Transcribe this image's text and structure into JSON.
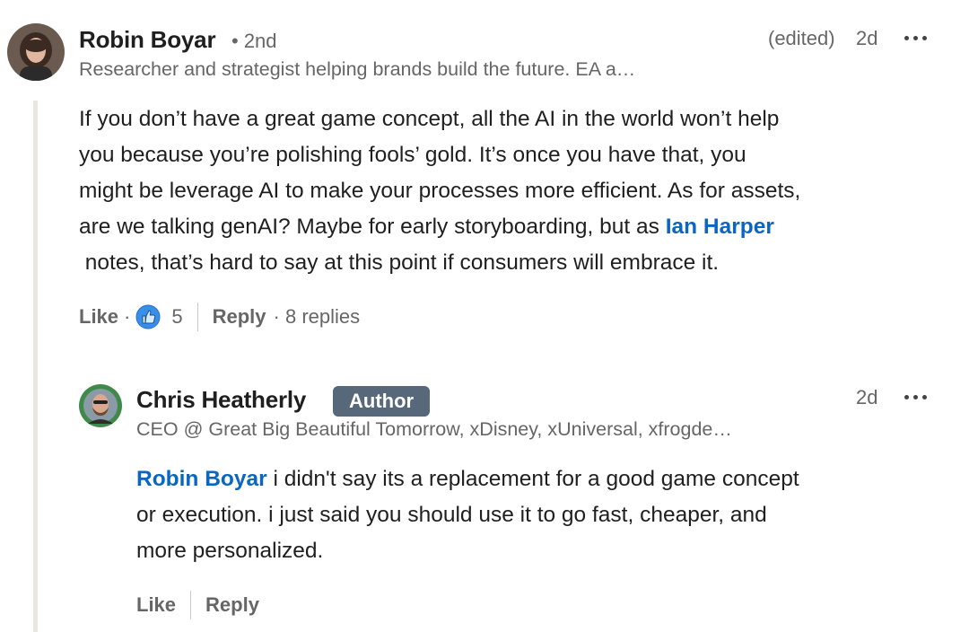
{
  "comment": {
    "author_name": "Robin Boyar",
    "degree": "• 2nd",
    "headline": "Researcher and strategist helping brands build the future. EA a…",
    "edited": "(edited)",
    "time": "2d",
    "body": {
      "line1": "If you don’t have a great game concept, all the AI in the world won’t help",
      "line2": "you because you’re polishing fools’ gold. It’s once you have that, you",
      "line3": "might be leverage AI to make your processes more efficient. As for assets,",
      "line4_text": "are we talking genAI? Maybe for early storyboarding, but as ",
      "line4_mention": "Ian Harper",
      "line5": " notes, that’s hard to say at this point if consumers will embrace it."
    },
    "actions": {
      "like_label": "Like",
      "dot": "·",
      "reaction_count": "5",
      "reply_label": "Reply",
      "replies_count": "· 8 replies"
    },
    "icons": {
      "reaction": "thumbs-up-icon",
      "more": "more-options-icon"
    }
  },
  "reply": {
    "author_name": "Chris Heatherly",
    "badge": "Author",
    "headline": "CEO @ Great Big Beautiful Tomorrow, xDisney, xUniversal, xfrogde…",
    "time": "2d",
    "body": {
      "mention": "Robin Boyar",
      "line1_text": " i didn't say its a replacement for a good game concept",
      "line2": "or execution. i just said you should use it to go fast, cheaper, and",
      "line3": "more personalized."
    },
    "actions": {
      "like_label": "Like",
      "reply_label": "Reply"
    }
  },
  "colors": {
    "mention": "#0a66c2",
    "badge_bg": "#56687a",
    "thread_line": "#ebe6e1",
    "reaction_blue": "#378fe9"
  }
}
